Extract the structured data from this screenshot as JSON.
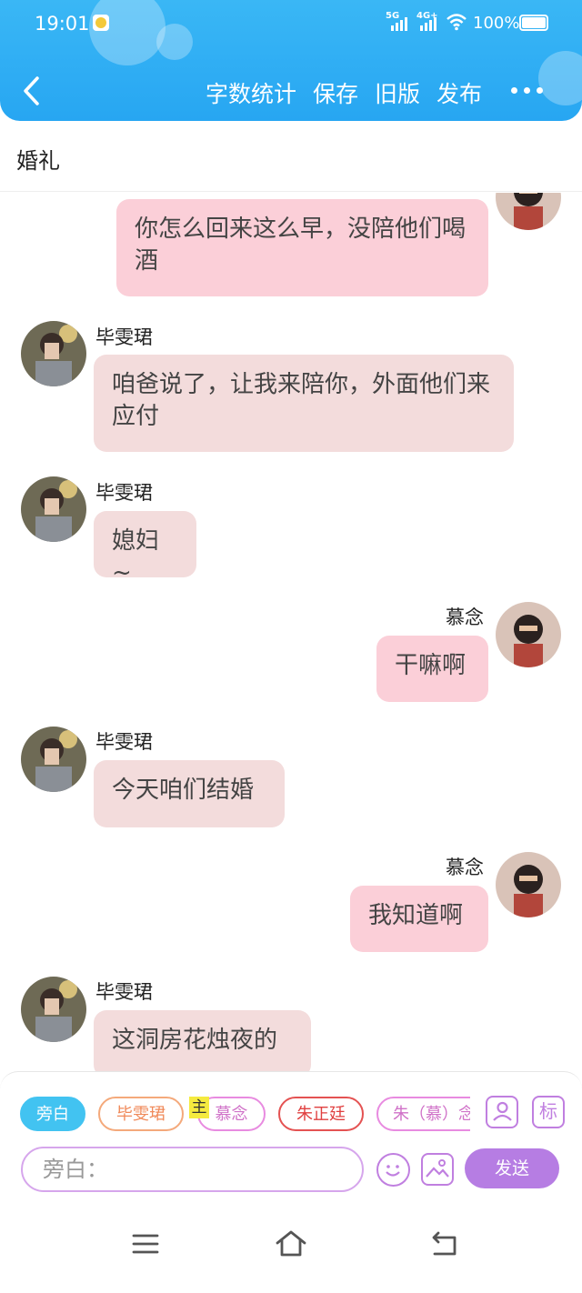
{
  "status_bar": {
    "time": "19:01",
    "network_1": "5G",
    "network_2": "4G+",
    "battery": "100%",
    "icons": [
      "notification-icon",
      "signal-icon",
      "wifi-icon",
      "battery-icon"
    ]
  },
  "header": {
    "back_icon": "chevron-left-icon",
    "actions": [
      "字数统计",
      "保存",
      "旧版",
      "发布"
    ],
    "more_icon": "more-dots-icon",
    "gradient_colors": [
      "#3ab7f5",
      "#27a6f2"
    ]
  },
  "title": "婚礼",
  "chat": {
    "colors": {
      "left_bubble": "#f3dcdc",
      "right_bubble": "#fbcfd8"
    },
    "messages": [
      {
        "side": "right",
        "speaker": "",
        "text": "你怎么回来这么早，没陪他们喝酒"
      },
      {
        "side": "left",
        "speaker": "毕雯珺",
        "text": "咱爸说了，让我来陪你，外面他们来应付"
      },
      {
        "side": "left",
        "speaker": "毕雯珺",
        "text": "媳妇~"
      },
      {
        "side": "right",
        "speaker": "慕念",
        "text": "干嘛啊"
      },
      {
        "side": "left",
        "speaker": "毕雯珺",
        "text": "今天咱们结婚"
      },
      {
        "side": "right",
        "speaker": "慕念",
        "text": "我知道啊"
      },
      {
        "side": "left",
        "speaker": "毕雯珺",
        "text": "这洞房花烛夜的"
      }
    ]
  },
  "composer": {
    "roles": [
      "旁白",
      "毕雯珺",
      "慕念",
      "朱正廷",
      "朱（慕）念"
    ],
    "selected_role": "旁白",
    "main_tag": "主",
    "role_manage_icon": "person-card-icon",
    "tag_button": "标",
    "input_placeholder": "旁白：",
    "emoji_icon": "emoji-icon",
    "image_icon": "image-icon",
    "send_label": "发送",
    "accent_color": "#b67de3"
  },
  "navbar": {
    "icons": [
      "menu-icon",
      "home-icon",
      "back-icon"
    ]
  }
}
